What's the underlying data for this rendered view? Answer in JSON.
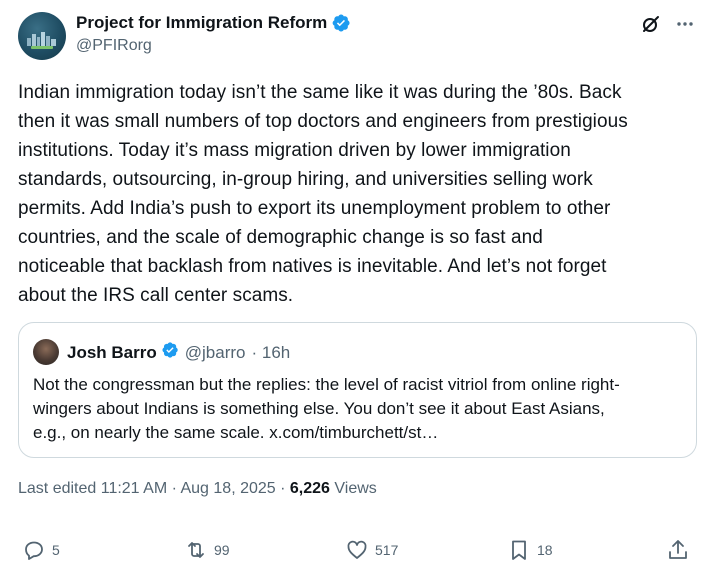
{
  "author": {
    "name": "Project for Immigration Reform",
    "handle": "@PFIRorg",
    "verified_color": "#1d9bf0"
  },
  "tweet": {
    "text": "Indian immigration today isn’t the same like it was during the ’80s. Back\nthen it was small numbers of top doctors and engineers from prestigious\ninstitutions. Today it’s mass migration driven by lower immigration\nstandards, outsourcing, in-group hiring, and universities selling work\npermits. Add India’s push to export its unemployment problem to other\ncountries, and the scale of demographic change is so fast and\nnoticeable that backlash from natives is inevitable. And let’s not forget\nabout the IRS call center scams."
  },
  "quote": {
    "name": "Josh Barro",
    "handle": "@jbarro",
    "time": "· 16h",
    "text": "Not the congressman but the replies: the level of racist vitriol from online right-\nwingers about Indians is something else. You don’t see it about East Asians,\ne.g., on nearly the same scale. x.com/timburchett/st…"
  },
  "meta": {
    "edited": "Last edited 11:21 AM · Aug 18, 2025 · ",
    "views_count": "6,226",
    "views_label": " Views"
  },
  "actions": {
    "replies": "5",
    "reposts": "99",
    "likes": "517",
    "bookmarks": "18"
  },
  "icons": [
    "grok-icon",
    "more-icon",
    "verified-badge-icon",
    "reply-icon",
    "repost-icon",
    "like-icon",
    "bookmark-icon",
    "share-icon"
  ]
}
